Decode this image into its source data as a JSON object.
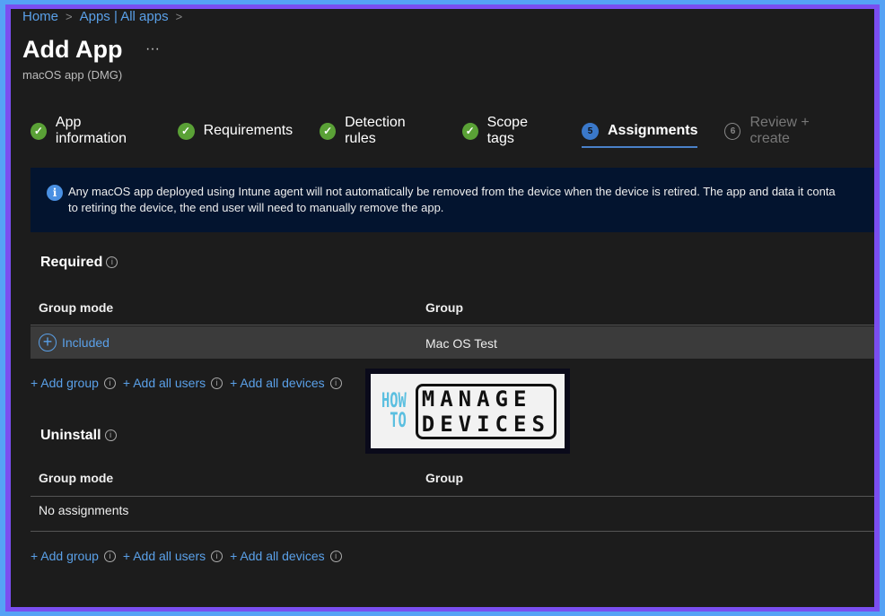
{
  "breadcrumb": {
    "items": [
      "Home",
      "Apps | All apps"
    ]
  },
  "header": {
    "title": "Add App",
    "more": "···",
    "subtitle": "macOS app (DMG)"
  },
  "steps": [
    {
      "label": "App information",
      "status": "complete"
    },
    {
      "label": "Requirements",
      "status": "complete"
    },
    {
      "label": "Detection rules",
      "status": "complete"
    },
    {
      "label": "Scope tags",
      "status": "complete"
    },
    {
      "number": "5",
      "label": "Assignments",
      "status": "active"
    },
    {
      "number": "6",
      "label": "Review + create",
      "status": "disabled"
    }
  ],
  "banner": {
    "line1": "Any macOS app deployed using Intune agent will not automatically be removed from the device when the device is retired. The app and data it conta",
    "line2": "to retiring the device, the end user will need to manually remove the app."
  },
  "required": {
    "title": "Required",
    "columns": [
      "Group mode",
      "Group"
    ],
    "rows": [
      {
        "mode": "Included",
        "group": "Mac OS Test"
      }
    ]
  },
  "uninstall": {
    "title": "Uninstall",
    "columns": [
      "Group mode",
      "Group"
    ],
    "empty": "No assignments"
  },
  "links": {
    "add_group": "+ Add group",
    "add_all_users": "+ Add all users",
    "add_all_devices": "+ Add all devices"
  },
  "logo": {
    "text": "HOW TO MANAGE DEVICES"
  },
  "colors": {
    "accent": "#5aa0e8",
    "success": "#5aa136",
    "banner": "#03142f",
    "frame": "#7a4ef0"
  }
}
